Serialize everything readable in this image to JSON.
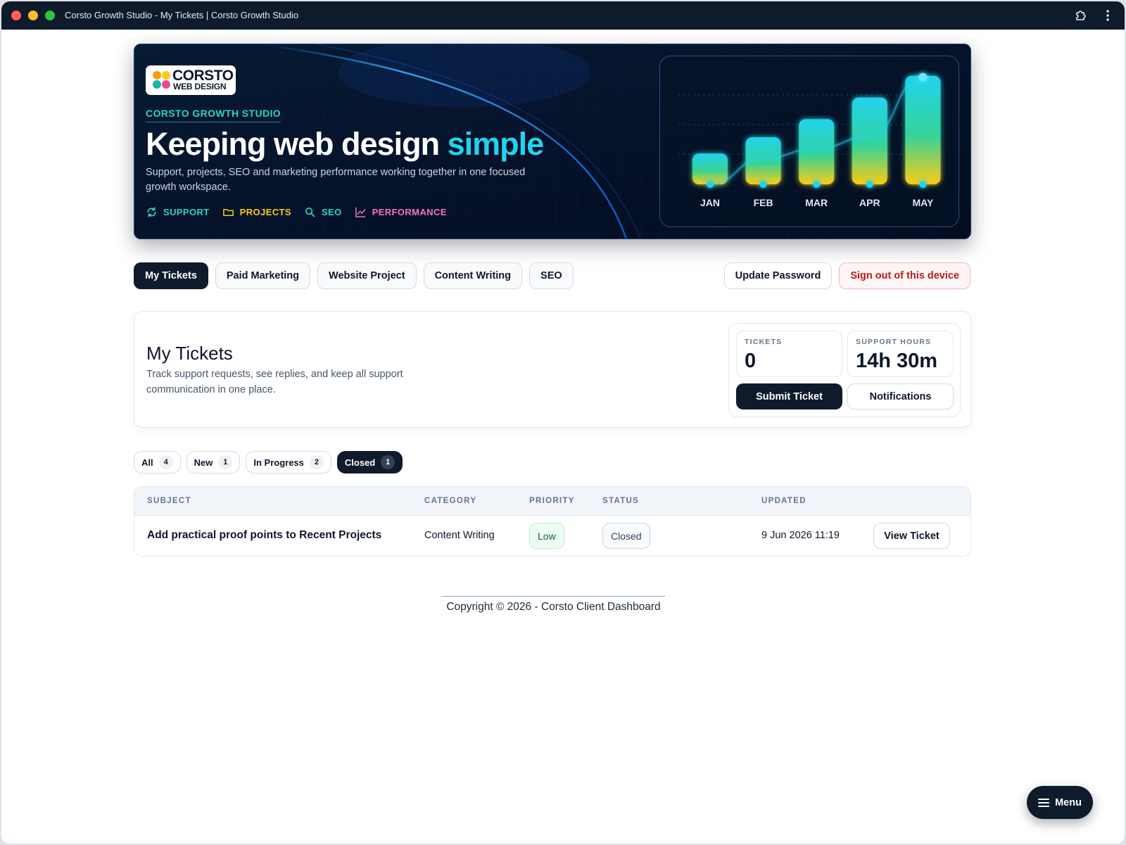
{
  "browser": {
    "title": "Corsto Growth Studio - My Tickets | Corsto Growth Studio"
  },
  "hero": {
    "logo_line1": "CORSTO",
    "logo_line2": "WEB DESIGN",
    "kicker": "CORSTO GROWTH STUDIO",
    "title_main": "Keeping web design ",
    "title_accent": "simple",
    "subtitle": "Support, projects, SEO and marketing performance working together in one focused growth workspace.",
    "pills": [
      {
        "label": "SUPPORT",
        "icon": "refresh-icon",
        "color": "#2dd4bf"
      },
      {
        "label": "PROJECTS",
        "icon": "folder-icon",
        "color": "#facc15"
      },
      {
        "label": "SEO",
        "icon": "search-icon",
        "color": "#2dd4bf"
      },
      {
        "label": "PERFORMANCE",
        "icon": "line-chart-icon",
        "color": "#f472b6"
      }
    ]
  },
  "chart_data": {
    "type": "bar",
    "categories": [
      "JAN",
      "FEB",
      "MAR",
      "APR",
      "MAY"
    ],
    "values": [
      1.7,
      2.6,
      3.6,
      4.8,
      6.0
    ],
    "title": "",
    "xlabel": "",
    "ylabel": "",
    "ylim": [
      0,
      6.3
    ],
    "grid": true,
    "colors": {
      "bar_top": "#22d3ee",
      "bar_mid": "#34d399",
      "bar_bottom": "#facc15",
      "trend_line": "#22d3ee"
    }
  },
  "tabs": [
    {
      "label": "My Tickets",
      "active": true
    },
    {
      "label": "Paid Marketing",
      "active": false
    },
    {
      "label": "Website Project",
      "active": false
    },
    {
      "label": "Content Writing",
      "active": false
    },
    {
      "label": "SEO",
      "active": false
    }
  ],
  "actions": {
    "update_password": "Update Password",
    "sign_out": "Sign out of this device"
  },
  "summary": {
    "title": "My Tickets",
    "description": "Track support requests, see replies, and keep all support communication in one place.",
    "tickets_label": "TICKETS",
    "tickets_value": "0",
    "hours_label": "SUPPORT HOURS",
    "hours_value": "14h 30m",
    "submit_label": "Submit Ticket",
    "notifications_label": "Notifications"
  },
  "filters": [
    {
      "label": "All",
      "count": "4",
      "active": false
    },
    {
      "label": "New",
      "count": "1",
      "active": false
    },
    {
      "label": "In Progress",
      "count": "2",
      "active": false
    },
    {
      "label": "Closed",
      "count": "1",
      "active": true
    }
  ],
  "table": {
    "headers": {
      "subject": "SUBJECT",
      "category": "CATEGORY",
      "priority": "PRIORITY",
      "status": "STATUS",
      "updated": "UPDATED"
    },
    "rows": [
      {
        "subject": "Add practical proof points to Recent Projects",
        "category": "Content Writing",
        "priority": "Low",
        "status": "Closed",
        "updated": "9 Jun 2026 11:19",
        "action": "View Ticket"
      }
    ]
  },
  "footer": {
    "copyright": "Copyright © 2026 - Corsto Client Dashboard"
  },
  "menu": {
    "label": "Menu"
  },
  "colors": {
    "navy": "#0f1a2b",
    "accent_cyan": "#22d3ee",
    "danger": "#b91c1c",
    "success": "#166534"
  }
}
